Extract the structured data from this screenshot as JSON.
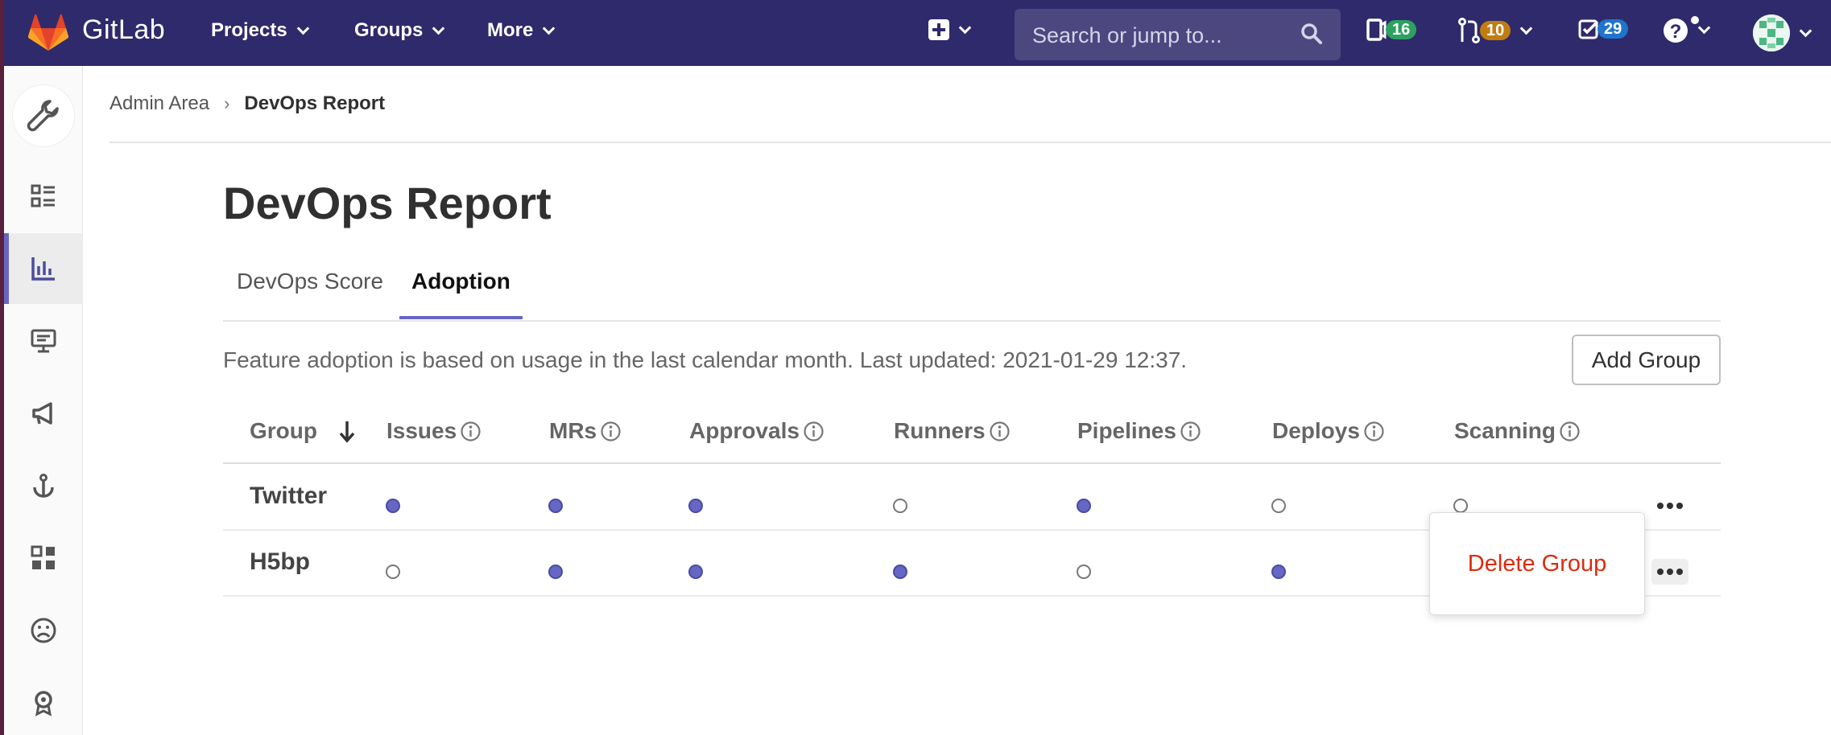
{
  "navbar": {
    "brand": "GitLab",
    "menus": [
      "Projects",
      "Groups",
      "More"
    ],
    "search_placeholder": "Search or jump to...",
    "counters": {
      "issues": "16",
      "merge_requests": "10",
      "todos": "29"
    },
    "colors": {
      "bg": "#2f2a6b",
      "issues": "#2da160",
      "merge_requests": "#c17d10",
      "todos": "#1f75cb"
    }
  },
  "sidebar": {
    "header_icon": "wrench-icon",
    "items": [
      {
        "icon": "overview-icon"
      },
      {
        "icon": "analytics-icon",
        "active": true
      },
      {
        "icon": "monitoring-icon"
      },
      {
        "icon": "messages-icon"
      },
      {
        "icon": "hooks-icon"
      },
      {
        "icon": "applications-icon"
      },
      {
        "icon": "abuse-reports-icon"
      },
      {
        "icon": "license-icon"
      }
    ]
  },
  "breadcrumb": {
    "parent": "Admin Area",
    "separator": "›",
    "current": "DevOps Report"
  },
  "page": {
    "title": "DevOps Report"
  },
  "tabs": [
    {
      "label": "DevOps Score",
      "active": false
    },
    {
      "label": "Adoption",
      "active": true
    }
  ],
  "description": "Feature adoption is based on usage in the last calendar month. Last updated: 2021-01-29 12:37.",
  "add_group_label": "Add Group",
  "table": {
    "columns": [
      "Group",
      "Issues",
      "MRs",
      "Approvals",
      "Runners",
      "Pipelines",
      "Deploys",
      "Scanning"
    ],
    "sort_indicator": "↓",
    "rows": [
      {
        "group": "Twitter",
        "adoption": [
          true,
          true,
          true,
          false,
          true,
          false,
          false
        ]
      },
      {
        "group": "H5bp",
        "adoption": [
          false,
          true,
          true,
          true,
          false,
          true,
          null
        ]
      }
    ]
  },
  "row_menu": {
    "open_row": 1,
    "items": [
      "Delete Group"
    ],
    "danger_color": "#dd2b0e"
  }
}
